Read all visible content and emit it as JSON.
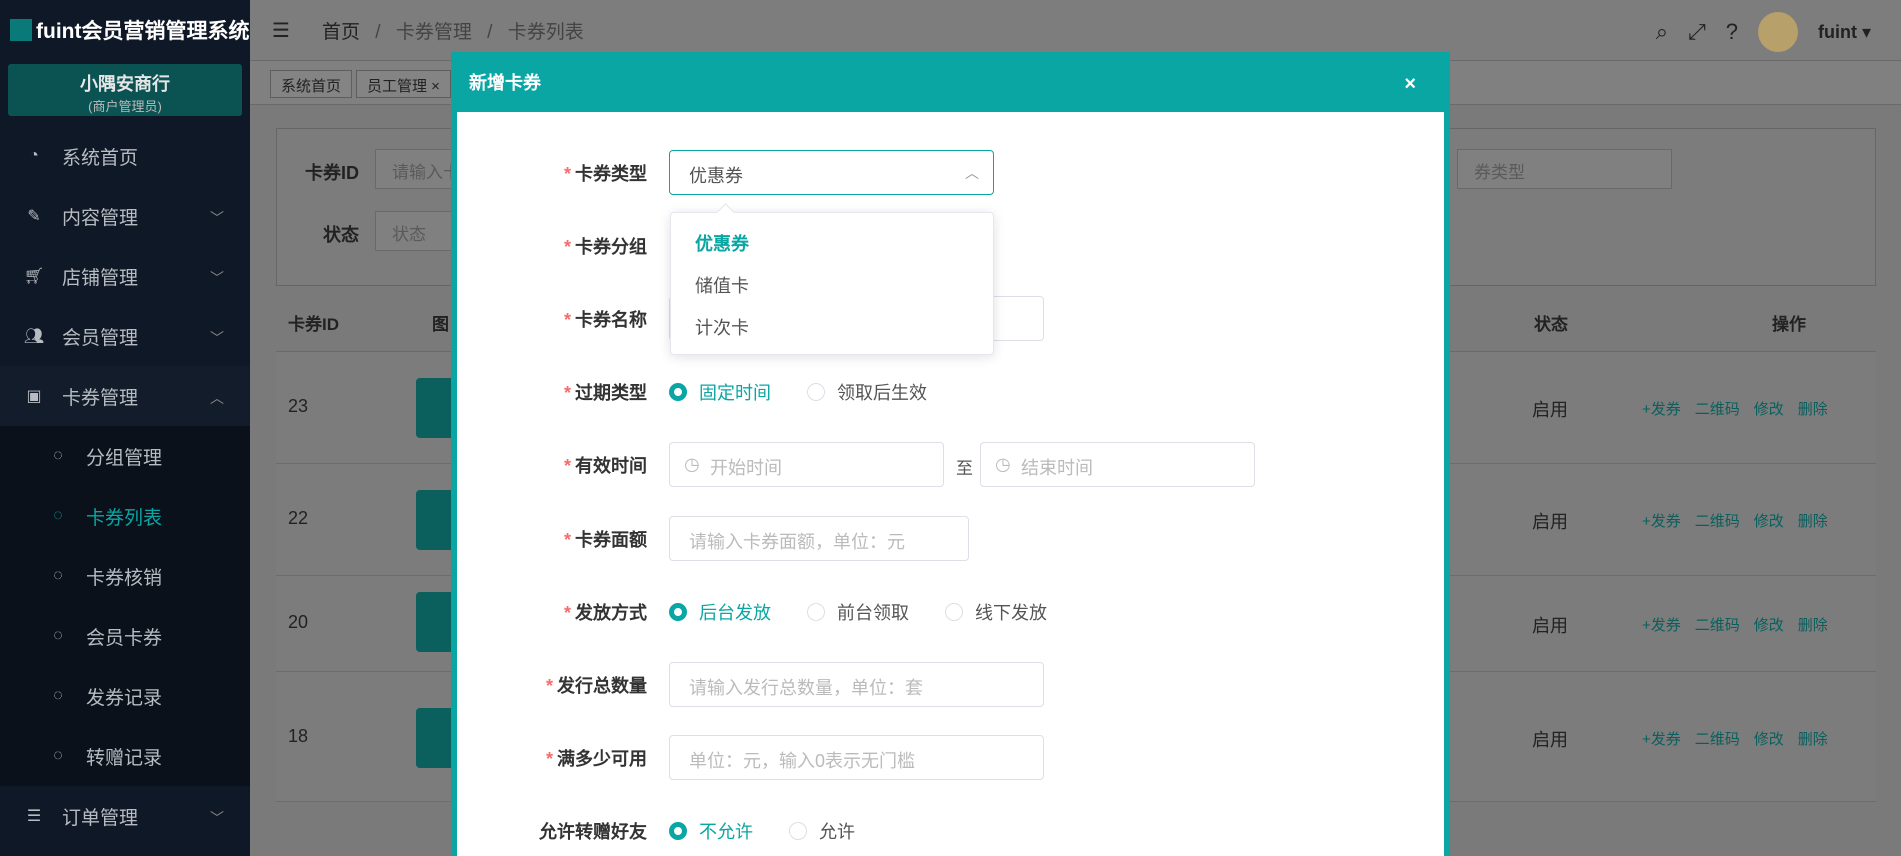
{
  "app": {
    "title": "fuint会员营销管理系统"
  },
  "store": {
    "name": "小隅安商行",
    "role": "(商户管理员)"
  },
  "sidebar": {
    "items": [
      {
        "label": "系统首页",
        "icon": "dashboard-icon"
      },
      {
        "label": "内容管理",
        "icon": "edit-icon"
      },
      {
        "label": "店铺管理",
        "icon": "cart-icon"
      },
      {
        "label": "会员管理",
        "icon": "user-icon"
      },
      {
        "label": "卡券管理",
        "icon": "coupon-icon"
      }
    ],
    "sub_items": [
      {
        "label": "分组管理"
      },
      {
        "label": "卡券列表"
      },
      {
        "label": "卡券核销"
      },
      {
        "label": "会员卡券"
      },
      {
        "label": "发券记录"
      },
      {
        "label": "转赠记录"
      }
    ],
    "order": {
      "label": "订单管理"
    }
  },
  "header": {
    "breadcrumb": [
      "首页",
      "卡券管理",
      "卡券列表"
    ],
    "separator": "/",
    "user": "fuint"
  },
  "tags": [
    {
      "label": "系统首页"
    },
    {
      "label": "员工管理 ×"
    }
  ],
  "filter": {
    "id_label": "卡券ID",
    "id_placeholder": "请输入卡",
    "status_label": "状态",
    "status_placeholder": "状态",
    "type_placeholder": "券类型"
  },
  "table": {
    "headers": [
      "卡券ID",
      "图",
      "状态",
      "操作"
    ],
    "rows": [
      {
        "id": "23",
        "status": "启用"
      },
      {
        "id": "22",
        "status": "启用"
      },
      {
        "id": "20",
        "status": "启用"
      },
      {
        "id": "18",
        "status": "启用"
      }
    ],
    "ops": [
      "+发券",
      "二维码",
      "修改",
      "删除"
    ]
  },
  "modal": {
    "title": "新增卡券",
    "close": "×",
    "type_label": "卡券类型",
    "type_value": "优惠券",
    "type_options": [
      "优惠券",
      "储值卡",
      "计次卡"
    ],
    "group_label": "卡券分组",
    "name_label": "卡券名称",
    "expire_label": "过期类型",
    "expire_options": [
      "固定时间",
      "领取后生效"
    ],
    "valid_label": "有效时间",
    "start_placeholder": "开始时间",
    "to": "至",
    "end_placeholder": "结束时间",
    "amount_label": "卡券面额",
    "amount_placeholder": "请输入卡券面额，单位：元",
    "send_label": "发放方式",
    "send_options": [
      "后台发放",
      "前台领取",
      "线下发放"
    ],
    "total_label": "发行总数量",
    "total_placeholder": "请输入发行总数量，单位：套",
    "threshold_label": "满多少可用",
    "threshold_placeholder": "单位：元，输入0表示无门槛",
    "gift_label": "允许转赠好友",
    "gift_options": [
      "不允许",
      "允许"
    ]
  },
  "colors": {
    "accent": "#0aa6a3",
    "sidebar": "#0f1826",
    "required": "#f56c6c"
  }
}
